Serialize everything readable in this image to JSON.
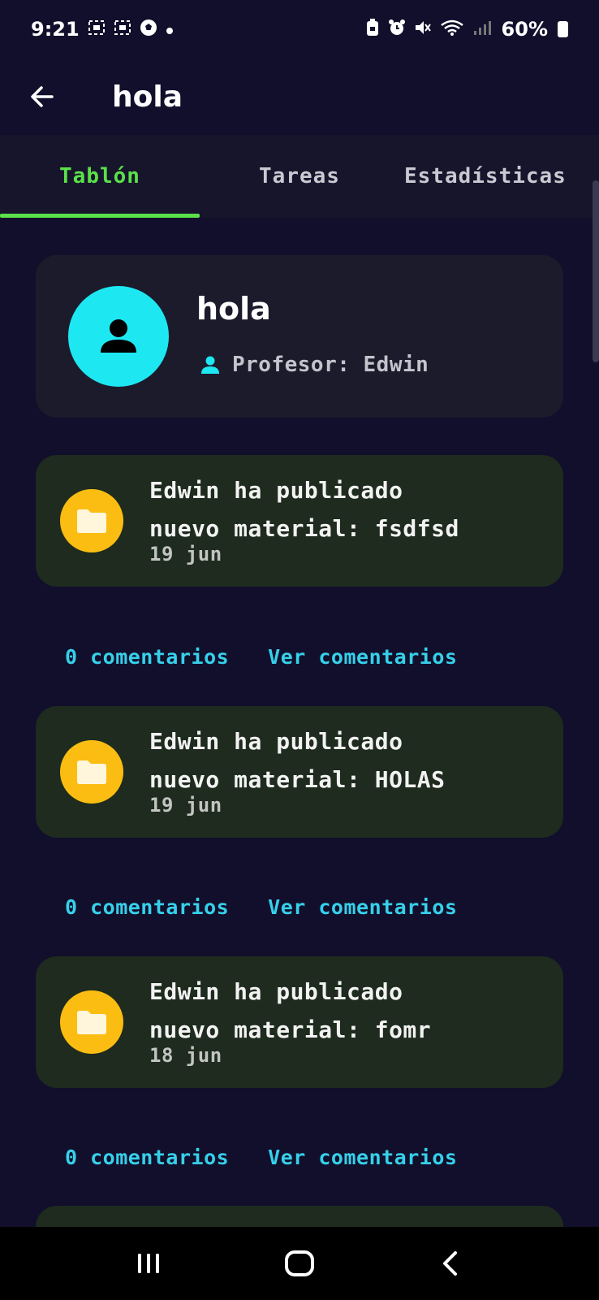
{
  "status_bar": {
    "time": "9:21",
    "battery_percent": "60%",
    "icons": [
      "screenshot-icon",
      "screenshot-icon",
      "soccer-ball-icon",
      "dot-icon",
      "battery-saver-icon",
      "alarm-icon",
      "mute-icon",
      "wifi-icon",
      "signal-icon",
      "battery-icon"
    ]
  },
  "app_bar": {
    "title": "hola",
    "back_icon": "arrow-left-icon"
  },
  "tabs": [
    {
      "label": "Tablón",
      "active": true
    },
    {
      "label": "Tareas",
      "active": false
    },
    {
      "label": "Estadísticas",
      "active": false
    }
  ],
  "class_header": {
    "title": "hola",
    "teacher_label": "Profesor: Edwin",
    "avatar_icon": "person-icon",
    "teacher_icon": "person-icon",
    "avatar_color": "#1de8f2"
  },
  "posts": [
    {
      "line1": "Edwin ha publicado",
      "line2": "nuevo material: fsdfsd",
      "date": "19 jun",
      "comments_count": "0 comentarios",
      "view_comments": "Ver comentarios"
    },
    {
      "line1": "Edwin ha publicado",
      "line2": "nuevo material: HOLAS",
      "date": "19 jun",
      "comments_count": "0 comentarios",
      "view_comments": "Ver comentarios"
    },
    {
      "line1": "Edwin ha publicado",
      "line2": "nuevo material: fomr",
      "date": "18 jun",
      "comments_count": "0 comentarios",
      "view_comments": "Ver comentarios"
    }
  ],
  "colors": {
    "background": "#110f2b",
    "accent_green": "#5be04a",
    "link_cyan": "#36d0ea",
    "folder_yellow": "#fbbd12",
    "post_card": "#1e2b1e"
  },
  "nav_bar": {
    "icons": [
      "recent-apps-icon",
      "home-icon",
      "back-icon"
    ]
  }
}
